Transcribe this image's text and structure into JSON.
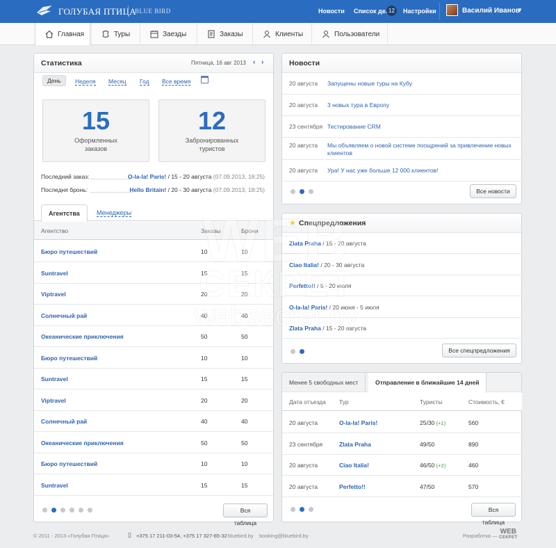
{
  "brand": {
    "name": "ГОЛУБАЯ ПТИЦА",
    "sub": "BLUE BIRD"
  },
  "topnav": {
    "news": "Новости",
    "todo": "Список дел",
    "todo_count": "12",
    "settings": "Настройки",
    "user": "Василий Иванов"
  },
  "mainnav": [
    "Главная",
    "Туры",
    "Заезды",
    "Заказы",
    "Клиенты",
    "Пользователи"
  ],
  "stats": {
    "title": "Статистика",
    "date": "Пятница, 16 авг 2013",
    "periods": [
      "День",
      "Неделя",
      "Месяц",
      "Год",
      "Все время"
    ],
    "box1": {
      "num": "15",
      "label": "Оформленных заказов"
    },
    "box2": {
      "num": "12",
      "label": "Забронированных туристов"
    },
    "last_order": {
      "label": "Последний заказ:",
      "tour": "O-la-la! Paris!",
      "dates": " / 15 - 20 августа",
      "ts": " (07.09.2013, 18:25)"
    },
    "last_booking": {
      "label": "Последня бронь:",
      "tour": "Hello Britain!",
      "dates": " / 20 - 30 августа",
      "ts": " (07.09.2013, 18:25)"
    },
    "tabs": {
      "agencies": "Агентства",
      "managers": "Менеджеры"
    },
    "cols": {
      "agency": "Агентство",
      "orders": "Заказы",
      "bookings": "Брони"
    },
    "rows": [
      {
        "name": "Бюро путешествий",
        "orders": "10",
        "bookings": "10"
      },
      {
        "name": "Suntravel",
        "orders": "15",
        "bookings": "15"
      },
      {
        "name": "Viptravel",
        "orders": "20",
        "bookings": "20"
      },
      {
        "name": "Солнечный рай",
        "orders": "40",
        "bookings": "40"
      },
      {
        "name": "Океанические приключения",
        "orders": "50",
        "bookings": "50"
      },
      {
        "name": "Бюро путешествий",
        "orders": "10",
        "bookings": "10"
      },
      {
        "name": "Suntravel",
        "orders": "15",
        "bookings": "15"
      },
      {
        "name": "Viptravel",
        "orders": "20",
        "bookings": "20"
      },
      {
        "name": "Солнечный рай",
        "orders": "40",
        "bookings": "40"
      },
      {
        "name": "Океанические приключения",
        "orders": "50",
        "bookings": "50"
      },
      {
        "name": "Бюро путешествий",
        "orders": "10",
        "bookings": "10"
      },
      {
        "name": "Suntravel",
        "orders": "15",
        "bookings": "15"
      }
    ],
    "all_button": "Вся таблица"
  },
  "news": {
    "title": "Новости",
    "items": [
      {
        "date": "20 августа",
        "text": "Запущены новые туры на Кубу"
      },
      {
        "date": "20 августа",
        "text": "3 новых тура в Европу"
      },
      {
        "date": "23 сентября",
        "text": "Тестирование CRM"
      },
      {
        "date": "20 августа",
        "text": "Мы объявляем о новой системе поощрений за привлечение новых клиентов"
      },
      {
        "date": "20 августа",
        "text": "Ура! У нас уже больше 12 000 клиентов!"
      }
    ],
    "all_button": "Все новости"
  },
  "specials": {
    "title": "Спецпредложения",
    "items": [
      {
        "tour": "Zlata Praha",
        "dates": " / 15 - 20 августа"
      },
      {
        "tour": "Ciao Italia!",
        "dates": " / 20 - 30 августа"
      },
      {
        "tour": "Perfetto!!",
        "dates": " / 5 - 20 июля"
      },
      {
        "tour": "O-la-la! Paris!",
        "dates": " / 20 июня - 5 июля"
      },
      {
        "tour": "Zlata Praha",
        "dates": " / 15 - 20 августа"
      }
    ],
    "all_button": "Все спецпредложения"
  },
  "departures": {
    "tab1": "Менее 5 свободных мест",
    "tab2": "Отправление в ближайшие 14 дней",
    "cols": {
      "date": "Дата отъезда",
      "tour": "Тур",
      "tourists": "Туристы",
      "cost": "Стоимость, €"
    },
    "rows": [
      {
        "date": "20 августа",
        "tour": "O-la-la! Paris!",
        "tourists": "25/30",
        "plus": "(+1)",
        "cost": "560"
      },
      {
        "date": "23 сентября",
        "tour": "Zlata Praha",
        "tourists": "49/50",
        "plus": "",
        "cost": "890"
      },
      {
        "date": "20 августа",
        "tour": "Ciao Italia!",
        "tourists": "46/50",
        "plus": "(+2)",
        "cost": "460"
      },
      {
        "date": "20 августа",
        "tour": "Perfetto!!",
        "tourists": "47/50",
        "plus": "",
        "cost": "570"
      }
    ],
    "all_button": "Вся таблица"
  },
  "footer": {
    "copy": "© 2011 - 2013 «Голубая Птица»",
    "phones": "+375 17 211-03-54, +375 17 327-65-32",
    "site": "bluebird.by",
    "email": "booking@bluebird.by",
    "dev": "Разработка —",
    "dev_logo": "WEB",
    "dev_logo_sub": "СЕКРЕТ"
  },
  "watermark": {
    "l1": "WEB",
    "l2": "СЕКРЕТ",
    "l3": "websecret.by"
  }
}
